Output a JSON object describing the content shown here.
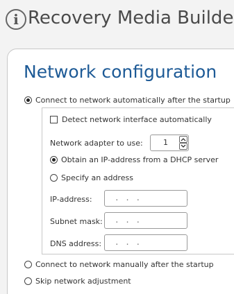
{
  "header": {
    "info_glyph": "i",
    "title": "Recovery Media Builder"
  },
  "section": {
    "title": "Network configuration"
  },
  "options": {
    "auto_connect": "Connect to network automatically after the startup",
    "detect_interface": "Detect network interface automatically",
    "adapter_label": "Network adapter to use:",
    "adapter_value": "1",
    "dhcp": "Obtain an IP-address from a DHCP server",
    "specify": "Specify an address",
    "ip_label": "IP-address:",
    "subnet_label": "Subnet mask:",
    "dns_label": "DNS address:",
    "ip_value": ". . .",
    "subnet_value": ". . .",
    "dns_value": ". . .",
    "manual_connect": "Connect to network manually after the startup",
    "skip": "Skip network adjustment"
  },
  "state": {
    "auto_connect_selected": true,
    "detect_interface_checked": false,
    "dhcp_selected": true
  },
  "icons": {
    "header": "info-icon",
    "stepper_up": "chevron-up-icon",
    "stepper_down": "chevron-down-icon"
  }
}
